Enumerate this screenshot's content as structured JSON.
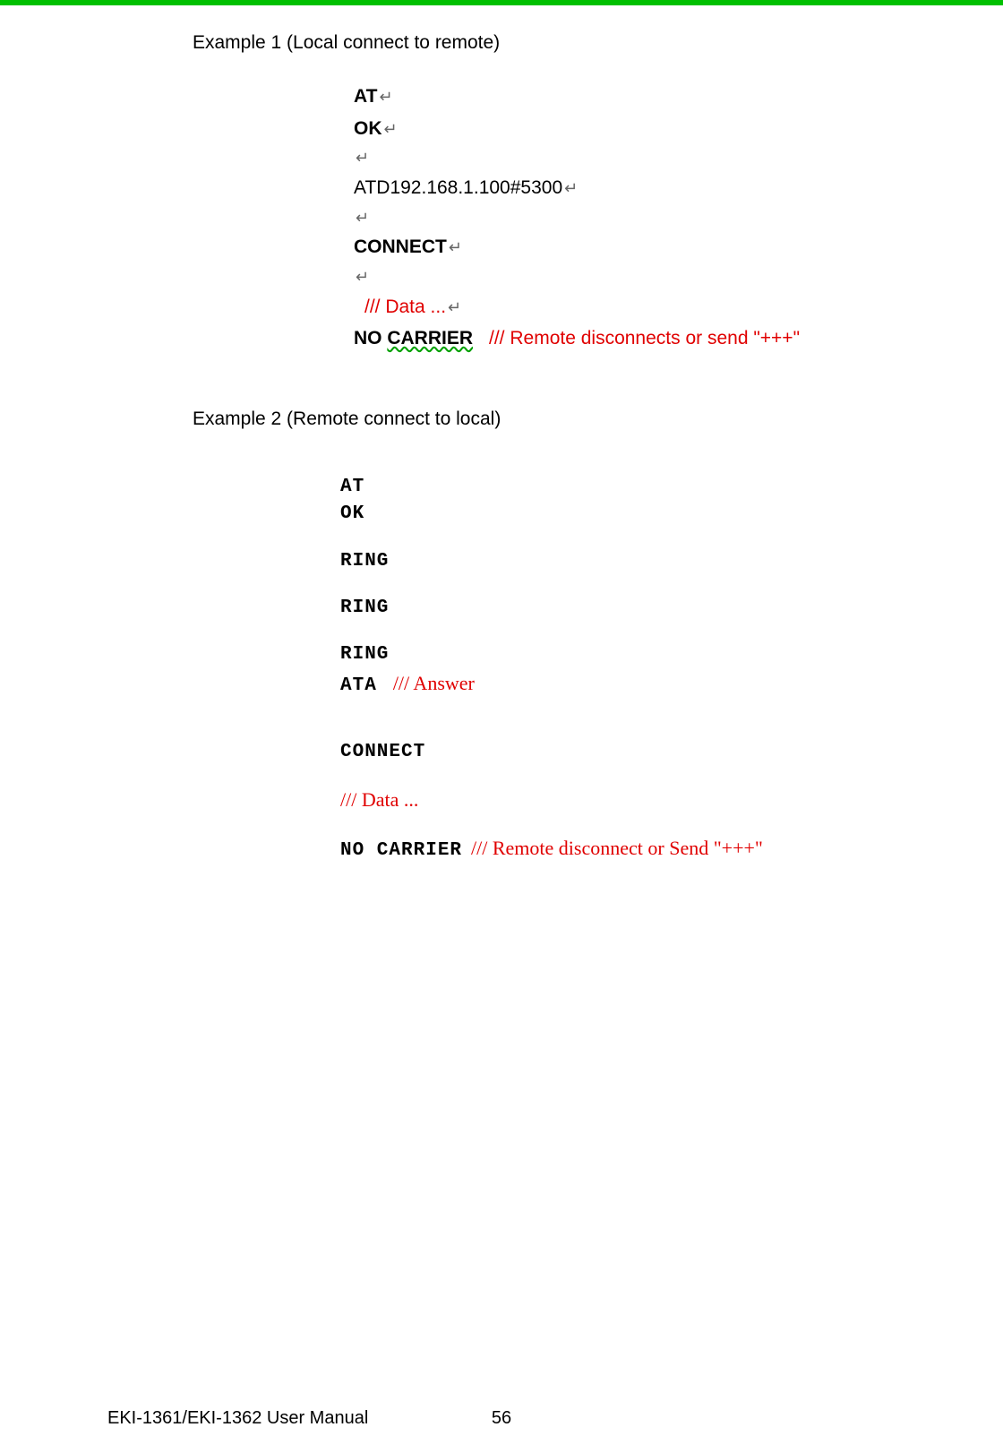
{
  "colors": {
    "topBar": "#00c000",
    "redAnnotation": "#e00000",
    "wavyUnderline": "#00a000"
  },
  "example1": {
    "heading": "Example 1 (Local connect to remote)",
    "crGlyph": "↵",
    "lines": {
      "at": "AT",
      "ok": "OK",
      "dial": "ATD192.168.1.100#5300",
      "connect": "CONNECT",
      "data": "/// Data ...",
      "noCarrier": "NO CARRIER",
      "noCarrierNote": "///  Remote disconnects  or send \"+++\""
    }
  },
  "example2": {
    "heading": "Example 2 (Remote connect to local)",
    "lines": {
      "at": "AT",
      "ok": "OK",
      "ring": "RING",
      "ata": "ATA",
      "ataNote": "/// Answer",
      "connect": "CONNECT",
      "data": "/// Data ...",
      "noCarrier": "NO CARRIER",
      "noCarrierNote": "/// Remote disconnect or Send \"+++\""
    }
  },
  "footer": {
    "left": "EKI-1361/EKI-1362 User Manual",
    "pageNumber": "56"
  }
}
